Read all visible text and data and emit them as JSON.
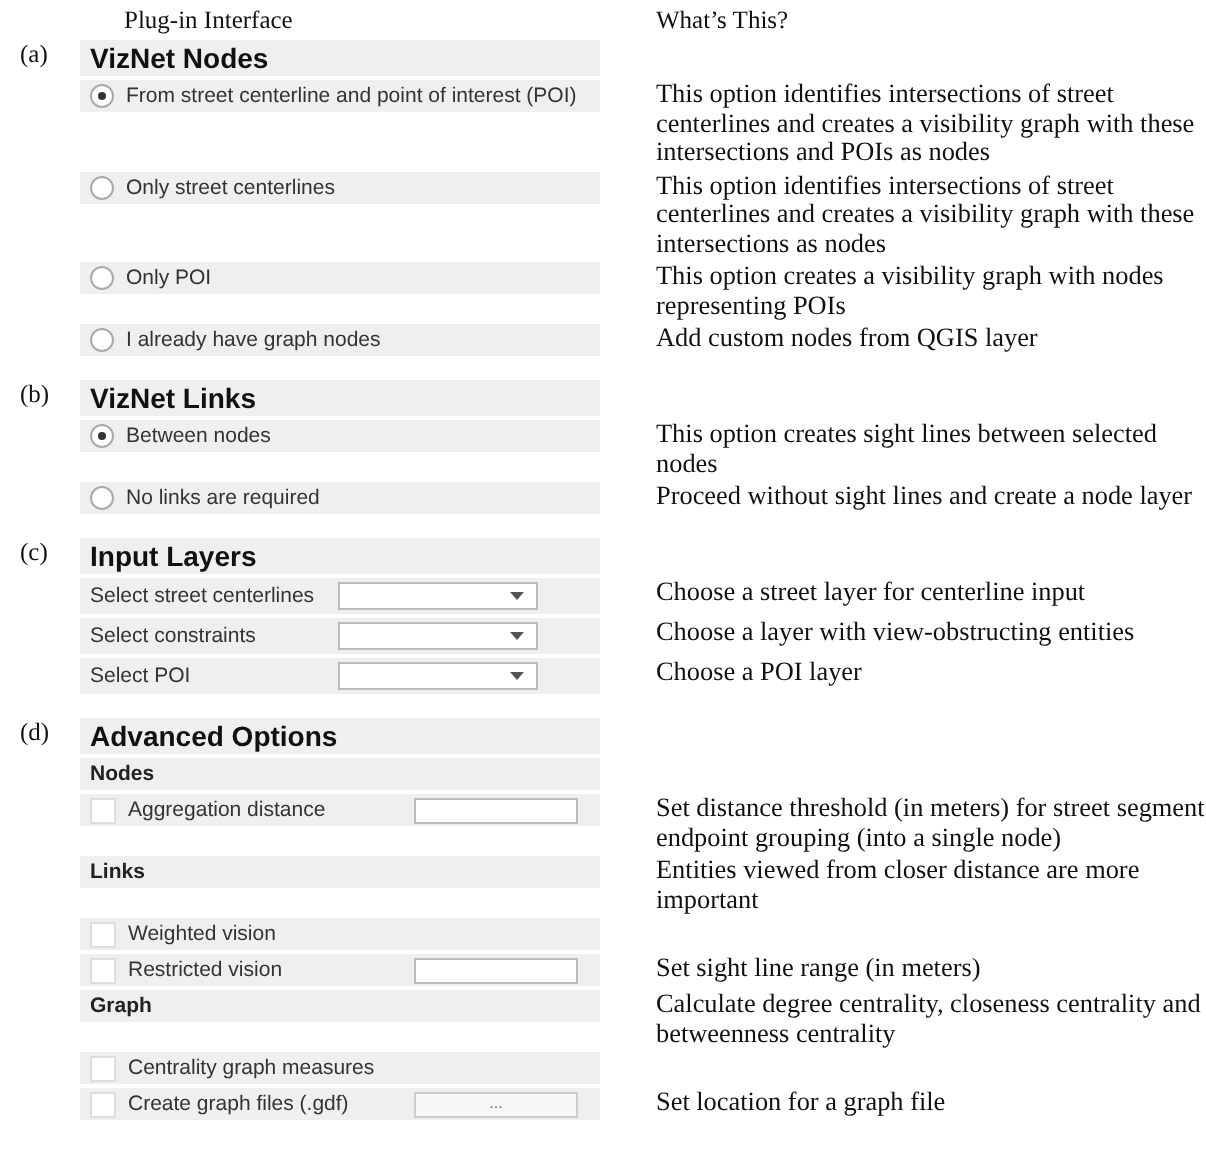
{
  "headers": {
    "interface": "Plug-in Interface",
    "help": "What’s This?"
  },
  "sections": [
    {
      "marker": "(a)",
      "title": "VizNet Nodes",
      "rows": [
        {
          "kind": "radio",
          "label": "From street centerline and point of interest (POI)",
          "selected": true,
          "help": "This option identifies intersections of street centerlines and creates a visibility graph with these intersections and POIs as nodes"
        },
        {
          "kind": "radio",
          "label": "Only street centerlines",
          "selected": false,
          "help": "This option identifies intersections of street centerlines and creates a visibility graph with these intersections  as nodes"
        },
        {
          "kind": "radio",
          "label": "Only POI",
          "selected": false,
          "help": "This option creates a visibility graph with nodes representing POIs"
        },
        {
          "kind": "radio",
          "label": "I already have graph nodes",
          "selected": false,
          "help": "Add custom nodes from QGIS layer"
        }
      ]
    },
    {
      "marker": "(b)",
      "title": "VizNet Links",
      "rows": [
        {
          "kind": "radio",
          "label": "Between nodes",
          "selected": true,
          "help": "This option creates sight lines between selected nodes"
        },
        {
          "kind": "radio",
          "label": "No links are required",
          "selected": false,
          "help": "Proceed without sight lines and create a node layer"
        }
      ]
    },
    {
      "marker": "(c)",
      "title": "Input Layers",
      "rows": [
        {
          "kind": "combo",
          "label": "Select street centerlines",
          "help": "Choose a street layer for centerline input"
        },
        {
          "kind": "combo",
          "label": "Select constraints",
          "help": "Choose a layer with view-obstructing entities"
        },
        {
          "kind": "combo",
          "label": "Select  POI",
          "help": "Choose a POI layer"
        }
      ]
    },
    {
      "marker": "(d)",
      "title": "Advanced Options",
      "rows": [
        {
          "kind": "subheading",
          "label": "Nodes"
        },
        {
          "kind": "checkbox",
          "label": "Aggregation distance",
          "checked": false,
          "field": {
            "kind": "text"
          },
          "help": "Set distance threshold (in meters) for street segment endpoint grouping (into a single node)"
        },
        {
          "kind": "subheading",
          "label": "Links",
          "help": "Entities viewed from closer distance are more important"
        },
        {
          "kind": "checkbox",
          "label": "Weighted vision",
          "checked": false
        },
        {
          "kind": "checkbox",
          "label": "Restricted vision",
          "checked": false,
          "field": {
            "kind": "text"
          },
          "help": "Set sight line range (in meters)"
        },
        {
          "kind": "subheading",
          "label": "Graph",
          "help": "Calculate degree centrality, closeness centrality and betweenness centrality"
        },
        {
          "kind": "checkbox",
          "label": "Centrality graph measures",
          "checked": false
        },
        {
          "kind": "checkbox",
          "label": "Create graph files (.gdf)",
          "checked": false,
          "field": {
            "kind": "button",
            "label": "..."
          },
          "help": "Set location for a graph file"
        }
      ]
    }
  ]
}
